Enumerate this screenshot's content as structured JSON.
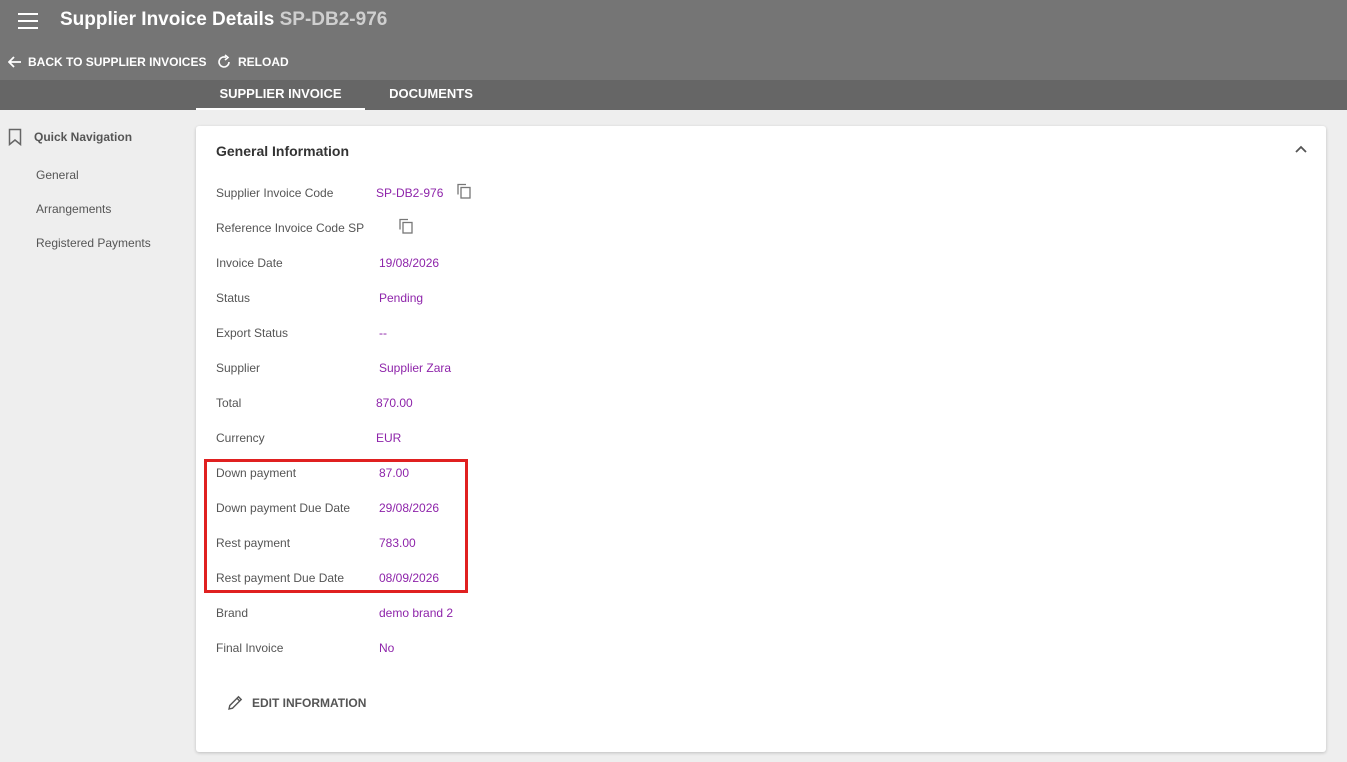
{
  "header": {
    "title": "Supplier Invoice Details",
    "code": "SP-DB2-976",
    "back_label": "BACK TO SUPPLIER INVOICES",
    "reload_label": "RELOAD"
  },
  "tabs": [
    {
      "label": "SUPPLIER INVOICE",
      "active": true
    },
    {
      "label": "DOCUMENTS",
      "active": false
    }
  ],
  "quick_nav": {
    "title": "Quick Navigation",
    "items": [
      "General",
      "Arrangements",
      "Registered Payments"
    ]
  },
  "card": {
    "title": "General Information",
    "fields": [
      {
        "label": "Supplier Invoice Code",
        "value": "SP-DB2-976"
      },
      {
        "label": "Reference Invoice Code SP",
        "value": ""
      },
      {
        "label": "Invoice Date",
        "value": "19/08/2026"
      },
      {
        "label": "Status",
        "value": "Pending"
      },
      {
        "label": "Export Status",
        "value": "--"
      },
      {
        "label": "Supplier",
        "value": "Supplier Zara"
      },
      {
        "label": "Total",
        "value": "870.00"
      },
      {
        "label": "Currency",
        "value": "EUR"
      },
      {
        "label": "Down payment",
        "value": "87.00"
      },
      {
        "label": "Down payment Due Date",
        "value": "29/08/2026"
      },
      {
        "label": "Rest payment",
        "value": "783.00"
      },
      {
        "label": "Rest payment Due Date",
        "value": "08/09/2026"
      },
      {
        "label": "Brand",
        "value": "demo brand 2"
      },
      {
        "label": "Final Invoice",
        "value": "No"
      }
    ],
    "edit_label": "EDIT INFORMATION"
  },
  "colors": {
    "topbar": "#757575",
    "tabbar": "#666666",
    "value_text": "#8e24aa",
    "highlight": "#e02020"
  }
}
